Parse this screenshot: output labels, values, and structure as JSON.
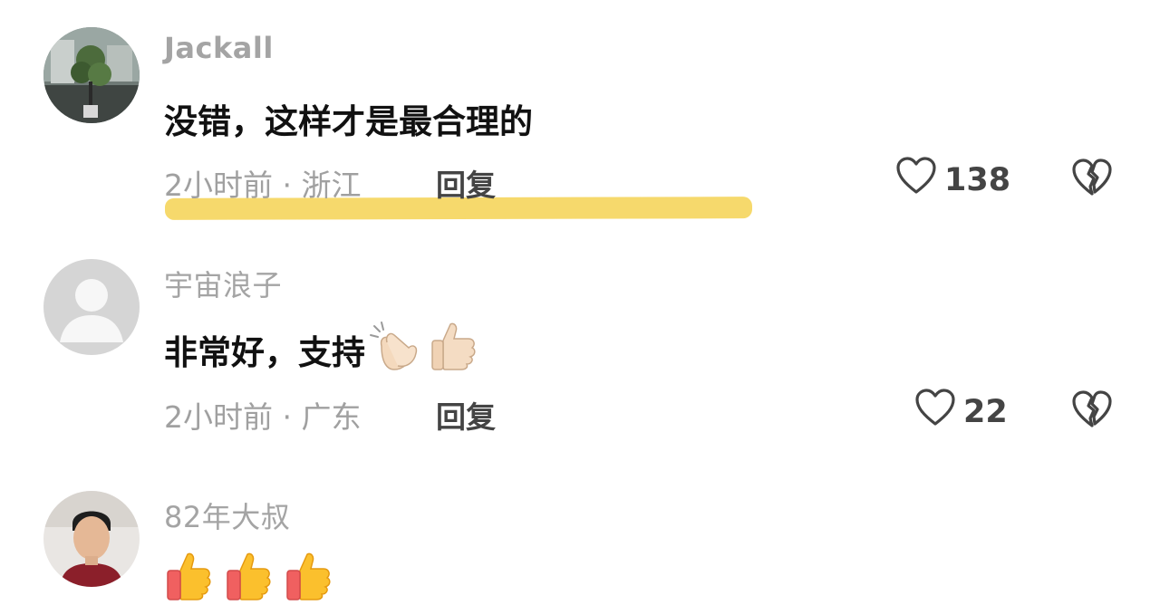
{
  "comments": [
    {
      "username": "Jackall",
      "text": "没错，这样才是最合理的",
      "meta": "2小时前 · 浙江",
      "reply_label": "回复",
      "likes": "138",
      "highlighted": true
    },
    {
      "username": "宇宙浪子",
      "text": "非常好，支持",
      "emojis": [
        "clapping-hands",
        "thumbs-up"
      ],
      "meta": "2小时前 · 广东",
      "reply_label": "回复",
      "likes": "22"
    },
    {
      "username": "82年大叔",
      "emojis": [
        "thumbs-up",
        "thumbs-up",
        "thumbs-up"
      ]
    }
  ],
  "icons": {
    "like": "heart-outline-icon",
    "dislike": "broken-heart-icon"
  },
  "colors": {
    "highlight": "#f5d55c",
    "username": "#a4a4a4",
    "text": "#111111",
    "meta": "#a0a0a0"
  }
}
